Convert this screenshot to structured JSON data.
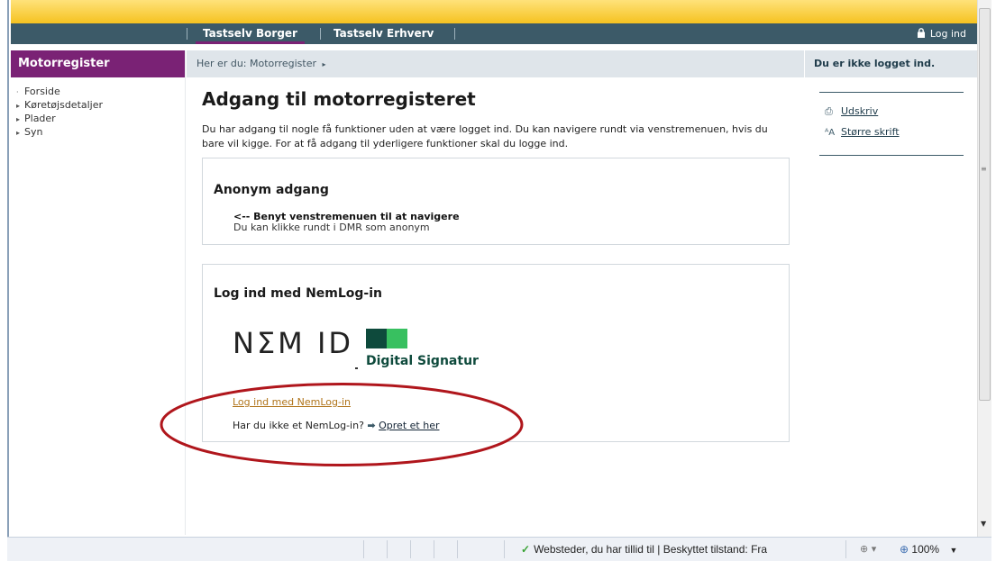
{
  "topnav": {
    "tabs": [
      {
        "label": "Tastselv Borger",
        "active": true
      },
      {
        "label": "Tastselv Erhverv",
        "active": false
      }
    ],
    "login_label": "Log ind"
  },
  "sidebar": {
    "title": "Motorregister",
    "items": [
      {
        "label": "Forside",
        "marker": "·"
      },
      {
        "label": "Køretøjsdetaljer",
        "marker": "▸"
      },
      {
        "label": "Plader",
        "marker": "▸"
      },
      {
        "label": "Syn",
        "marker": "▸"
      }
    ]
  },
  "breadcrumb": {
    "text": "Her er du: Motorregister",
    "arrow": "▸"
  },
  "main": {
    "title": "Adgang til motorregisteret",
    "intro": "Du har adgang til nogle få funktioner uden at være logget ind. Du kan navigere rundt via venstremenuen, hvis du bare vil kigge. For at få adgang til yderligere funktioner skal du logge ind.",
    "anon_box": {
      "title": "Anonym adgang",
      "strong": "<-- Benyt venstremenuen til at navigere",
      "sub": "Du kan klikke rundt i DMR som anonym"
    },
    "nemlogin_box": {
      "title": "Log ind med NemLog-in",
      "logo_text": "NΣM ID",
      "logo_sub": "Digital Signatur",
      "link": "Log ind med NemLog-in",
      "question": "Har du ikke et NemLog-in?",
      "create_link": "Opret et her"
    }
  },
  "right_panel": {
    "status": "Du er ikke logget ind.",
    "print_label": "Udskriv",
    "font_label": "Større skrift"
  },
  "statusbar": {
    "text": "Websteder, du har tillid til | Beskyttet tilstand: Fra",
    "zoom": "100%"
  },
  "colors": {
    "nav_bg": "#3c5a68",
    "accent_purple": "#7a2275",
    "gold": "#f5c220",
    "annotation_red": "#b0161c",
    "link_orange": "#b0741a"
  }
}
